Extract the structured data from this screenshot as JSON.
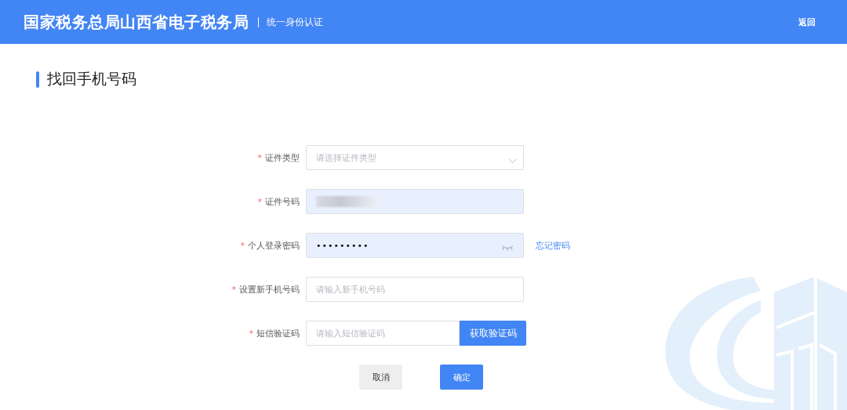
{
  "header": {
    "title": "国家税务总局山西省电子税务局",
    "subtitle": "统一身份认证",
    "back_link": "返回"
  },
  "page_title": "找回手机号码",
  "fields": [
    {
      "kind": "select",
      "marker": "*",
      "label": "证件类型",
      "placeholder": "请选择证件类型",
      "autofilled": false
    },
    {
      "kind": "blurred",
      "marker": "*",
      "label": "证件号码",
      "autofilled": true
    },
    {
      "kind": "password",
      "marker": "*",
      "label": "个人登录密码",
      "value": "•••••••••",
      "autofilled": true,
      "link": "忘记密码"
    },
    {
      "kind": "text",
      "marker": "*",
      "label": "设置新手机号码",
      "placeholder": "请输入新手机号码",
      "autofilled": false
    },
    {
      "kind": "sms",
      "marker": "*",
      "label": "短信验证码",
      "placeholder": "请输入短信验证码",
      "autofilled": false,
      "button": "获取验证码"
    }
  ],
  "buttons": [
    {
      "label": "取消",
      "kind": "secondary"
    },
    {
      "label": "确定",
      "kind": "primary"
    }
  ]
}
